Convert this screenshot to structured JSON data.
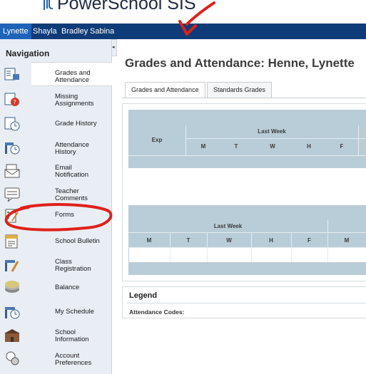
{
  "app": {
    "name": "PowerSchool SIS"
  },
  "students": [
    "Lynette",
    "Shayla",
    "Bradley",
    "Sabina"
  ],
  "active_student": "Lynette",
  "sidebar": {
    "heading": "Navigation",
    "items": [
      {
        "line1": "Grades and",
        "line2": "Attendance",
        "icon": "grades-attendance-icon"
      },
      {
        "line1": "Missing",
        "line2": "Assignments",
        "icon": "missing-assignments-icon"
      },
      {
        "line1": "Grade History",
        "line2": "",
        "icon": "grade-history-icon"
      },
      {
        "line1": "Attendance",
        "line2": "History",
        "icon": "attendance-history-icon"
      },
      {
        "line1": "Email",
        "line2": "Notification",
        "icon": "email-icon"
      },
      {
        "line1": "Teacher",
        "line2": "Comments",
        "icon": "comments-icon"
      },
      {
        "line1": "Forms",
        "line2": "",
        "icon": "forms-icon"
      },
      {
        "line1": "School Bulletin",
        "line2": "",
        "icon": "bulletin-icon"
      },
      {
        "line1": "Class",
        "line2": "Registration",
        "icon": "registration-icon"
      },
      {
        "line1": "Balance",
        "line2": "",
        "icon": "balance-icon"
      },
      {
        "line1": "My Schedule",
        "line2": "",
        "icon": "schedule-icon"
      },
      {
        "line1": "School",
        "line2": "Information",
        "icon": "school-icon"
      },
      {
        "line1": "Account",
        "line2": "Preferences",
        "icon": "account-icon"
      }
    ]
  },
  "main": {
    "title": "Grades and Attendance: Henne, Lynette",
    "tabs": [
      "Grades and Attendance",
      "Standards Grades"
    ],
    "table1": {
      "exp": "Exp",
      "group": "Last Week",
      "days": [
        "M",
        "T",
        "W",
        "H",
        "F"
      ]
    },
    "table2": {
      "group": "Last Week",
      "days": [
        "M",
        "T",
        "W",
        "H",
        "F",
        "M"
      ]
    },
    "legend": {
      "title": "Legend",
      "codes_label": "Attendance Codes:"
    }
  },
  "colors": {
    "header_bar": "#0e3c78",
    "active_tab": "#1e63b8",
    "grid": "#b9cdd8",
    "annotation": "#e0201b"
  }
}
